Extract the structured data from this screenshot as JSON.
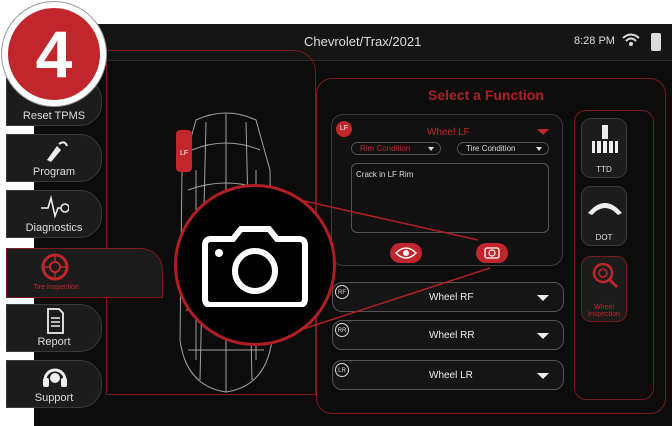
{
  "step": {
    "number": "4"
  },
  "status_bar": {
    "title": "Chevrolet/Trax/2021",
    "time": "8:28 PM"
  },
  "sidebar": {
    "items": [
      {
        "label": "Reset TPMS",
        "icon": "reset-tpms-icon"
      },
      {
        "label": "Program",
        "icon": "program-icon"
      },
      {
        "label": "Diagnostics",
        "icon": "diagnostics-icon"
      },
      {
        "label": "Tire Inspection",
        "icon": "tire-icon",
        "active": true
      },
      {
        "label": "Report",
        "icon": "report-icon"
      },
      {
        "label": "Support",
        "icon": "support-icon"
      }
    ]
  },
  "car": {
    "tire_tag": "LF"
  },
  "main": {
    "title": "Select a Function",
    "active_wheel": {
      "tag": "LF",
      "label": "Wheel LF",
      "rim_condition": "Rim Condition",
      "tire_condition": "Tire Condition",
      "note": "Crack in LF Rim"
    },
    "wheels": [
      {
        "tag": "RF",
        "label": "Wheel RF"
      },
      {
        "tag": "RR",
        "label": "Wheel RR"
      },
      {
        "tag": "LR",
        "label": "Wheel LR"
      }
    ]
  },
  "tools": [
    {
      "label": "TTD",
      "icon": "tread-depth-icon"
    },
    {
      "label": "DOT",
      "icon": "dot-code-icon"
    },
    {
      "label": "Wheel Inspection",
      "icon": "wheel-inspection-icon"
    }
  ],
  "zoom": {
    "icon": "camera-icon"
  },
  "colors": {
    "accent": "#c0262b",
    "background": "#111111"
  }
}
